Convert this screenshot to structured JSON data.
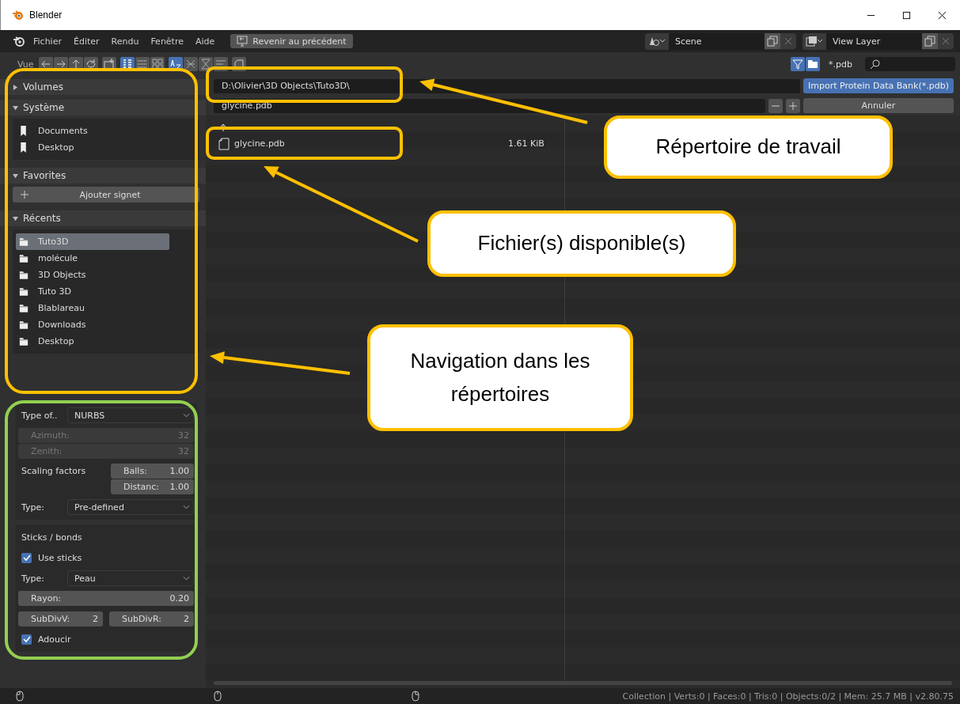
{
  "window": {
    "title": "Blender"
  },
  "menu": [
    "Fichier",
    "Éditer",
    "Rendu",
    "Fenêtre",
    "Aide"
  ],
  "back_button": "Revenir au précédent",
  "scene": "Scene",
  "view_layer": "View Layer",
  "toolbar": {
    "label": "Vue",
    "display_modes": [
      {
        "selected": true
      },
      {
        "selected": false
      },
      {
        "selected": false
      }
    ],
    "sort_modes": [
      {
        "selected": true
      },
      {
        "selected": false
      },
      {
        "selected": false
      },
      {
        "selected": false
      }
    ],
    "filter_on": true,
    "folders_on": true,
    "filter": "*.pdb"
  },
  "path": "D:\\Olivier\\3D Objects\\Tuto3D\\",
  "filename": "glycine.pdb",
  "import_button": "Import Protein Data Bank(*.pdb)",
  "cancel_button": "Annuler",
  "files": [
    {
      "name": "glycine.pdb",
      "size": "1.61 KiB"
    }
  ],
  "sidebar": [
    {
      "kind": "bookmarks",
      "title": "Volumes",
      "expanded": false
    },
    {
      "kind": "bookmarks",
      "title": "Système",
      "expanded": true,
      "items": [
        {
          "label": "Documents",
          "selected": false
        },
        {
          "label": "Desktop",
          "selected": false
        }
      ]
    },
    {
      "kind": "button",
      "title": "Favorites",
      "expanded": true,
      "button": "Ajouter signet"
    },
    {
      "kind": "recents",
      "title": "Récents",
      "expanded": true,
      "items": [
        {
          "label": "Tuto3D",
          "selected": true
        },
        {
          "label": "molécule",
          "selected": false
        },
        {
          "label": "3D Objects",
          "selected": false
        },
        {
          "label": "Tuto 3D",
          "selected": false
        },
        {
          "label": "Blablareau",
          "selected": false
        },
        {
          "label": "Downloads",
          "selected": false
        },
        {
          "label": "Desktop",
          "selected": false
        }
      ]
    }
  ],
  "operator": [
    {
      "rows": [
        {
          "kind": "dropdown",
          "label": "Type of..",
          "value": "NURBS"
        },
        {
          "kind": "numbers",
          "disabled": true,
          "fields": [
            {
              "label": "Azimuth:",
              "value": "32"
            },
            {
              "label": "Zenith:",
              "value": "32"
            }
          ]
        },
        {
          "kind": "labeled_numbers",
          "label": "Scaling factors",
          "fields": [
            {
              "label": "Balls:",
              "value": "1.00"
            },
            {
              "label": "Distanc:",
              "value": "1.00"
            }
          ]
        },
        {
          "kind": "dropdown",
          "label": "Type:",
          "value": "Pre-defined"
        }
      ]
    },
    {
      "rows": [
        {
          "kind": "heading",
          "label": "Sticks / bonds"
        },
        {
          "kind": "checkbox",
          "label": "Use sticks",
          "checked": true
        },
        {
          "kind": "dropdown",
          "label": "Type:",
          "value": "Peau"
        },
        {
          "kind": "numbers",
          "disabled": false,
          "fields": [
            {
              "label": "Rayon:",
              "value": "0.20"
            }
          ]
        },
        {
          "kind": "inline_numbers",
          "fields": [
            {
              "label": "SubDivV:",
              "value": "2"
            },
            {
              "label": "SubDivR:",
              "value": "2"
            }
          ]
        },
        {
          "kind": "checkbox",
          "label": "Adoucir",
          "checked": true
        }
      ]
    }
  ],
  "status_bar": "Collection | Verts:0 | Faces:0 | Tris:0 | Objects:0/2 | Mem: 25.7 MB | v2.80.75",
  "annotations": {
    "highlights": [
      {
        "color": "#ffc000"
      },
      {
        "color": "#ffc000"
      },
      {
        "color": "#ffc000"
      },
      {
        "color": "#92d050"
      }
    ],
    "callouts": [
      "Répertoire de travail",
      "Fichier(s) disponible(s)",
      "Navigation dans les répertoires"
    ]
  }
}
